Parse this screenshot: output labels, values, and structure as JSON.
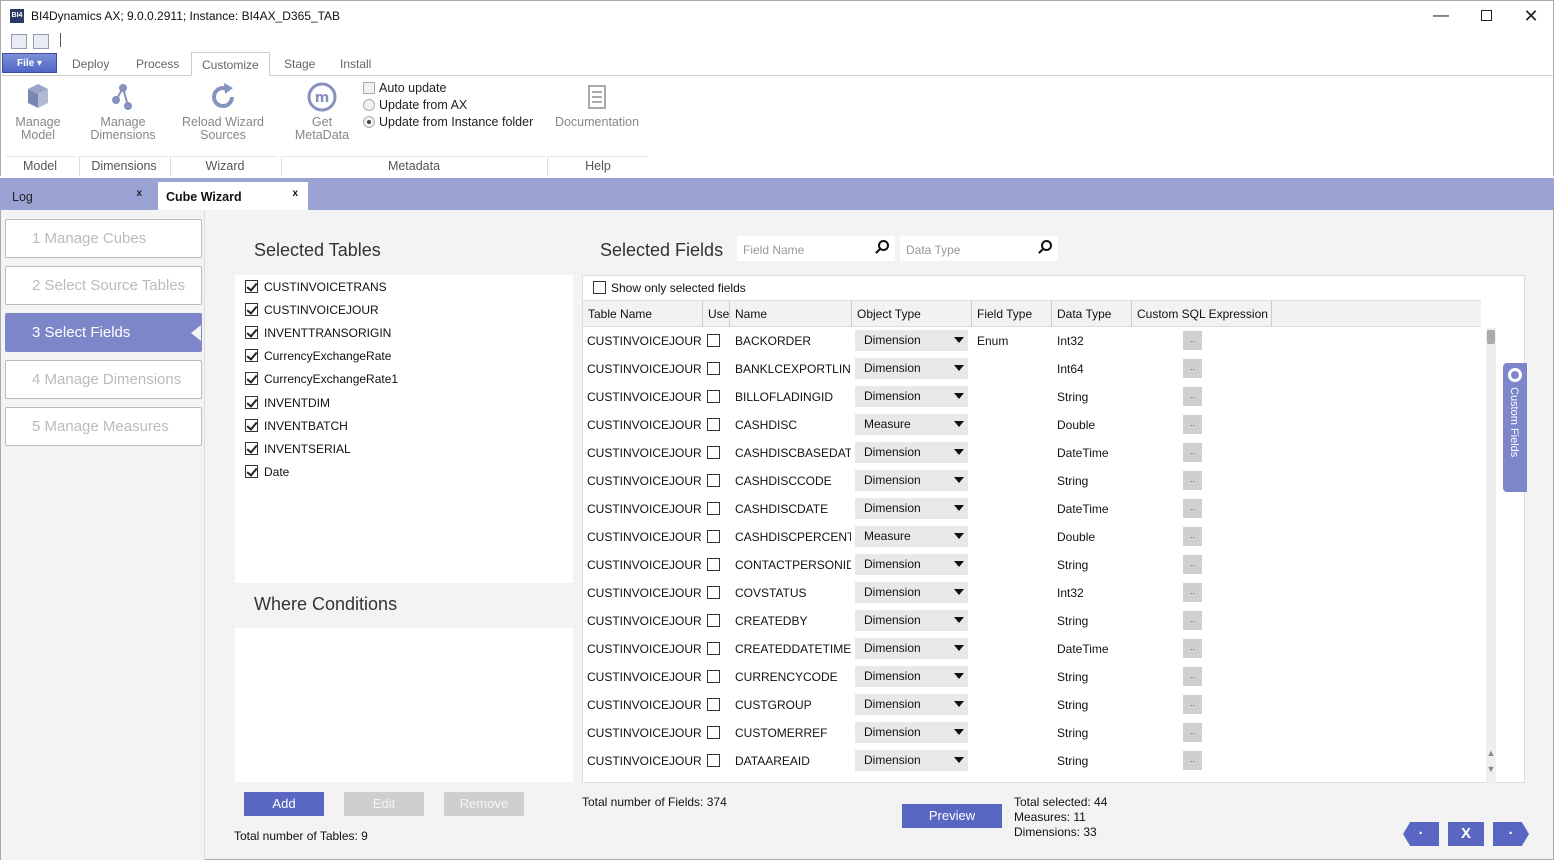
{
  "window": {
    "title": "BI4Dynamics AX; 9.0.0.2911;  Instance: BI4AX_D365_TAB",
    "app_icon_text": "BI4",
    "minimize": "—",
    "close": "✕"
  },
  "ribbon_tabs": {
    "file": "File ▾",
    "tabs": [
      "Deploy",
      "Process",
      "Customize",
      "Stage",
      "Install"
    ],
    "active": "Customize"
  },
  "ribbon": {
    "buttons": {
      "manage_model": "Manage\nModel",
      "manage_dimensions": "Manage\nDimensions",
      "reload_wizard": "Reload Wizard\nSources",
      "get_metadata": "Get\nMetaData",
      "documentation": "Documentation"
    },
    "options": {
      "auto_update": "Auto update",
      "update_from_ax": "Update from AX",
      "update_from_instance": "Update from Instance folder"
    },
    "groups": [
      "Model",
      "Dimensions",
      "Wizard",
      "Metadata",
      "Help"
    ]
  },
  "doc_tabs": {
    "log": "Log",
    "cube_wizard": "Cube Wizard",
    "close_glyph": "x"
  },
  "steps": [
    "1   Manage Cubes",
    "2   Select Source Tables",
    "3   Select Fields",
    "4   Manage Dimensions",
    "5   Manage Measures"
  ],
  "active_step": 3,
  "selected_tables": {
    "heading": "Selected Tables",
    "items": [
      "CUSTINVOICETRANS",
      "CUSTINVOICEJOUR",
      "INVENTTRANSORIGIN",
      "CurrencyExchangeRate",
      "CurrencyExchangeRate1",
      "INVENTDIM",
      "INVENTBATCH",
      "INVENTSERIAL",
      "Date"
    ]
  },
  "where_conditions": {
    "heading": "Where Conditions",
    "add": "Add",
    "edit": "Edit",
    "remove": "Remove",
    "total_tables": "Total number of Tables: 9"
  },
  "selected_fields": {
    "heading": "Selected Fields",
    "field_name_placeholder": "Field Name",
    "data_type_placeholder": "Data Type",
    "show_only_selected": "Show only selected fields",
    "columns": [
      "Table Name",
      "Use",
      "Name",
      "Object Type",
      "Field Type",
      "Data Type",
      "Custom SQL Expression"
    ],
    "rows": [
      {
        "table": "CUSTINVOICEJOUR",
        "name": "BACKORDER",
        "object_type": "Dimension",
        "field_type": "Enum",
        "data_type": "Int32"
      },
      {
        "table": "CUSTINVOICEJOUR",
        "name": "BANKLCEXPORTLINE",
        "object_type": "Dimension",
        "field_type": "",
        "data_type": "Int64"
      },
      {
        "table": "CUSTINVOICEJOUR",
        "name": "BILLOFLADINGID",
        "object_type": "Dimension",
        "field_type": "",
        "data_type": "String"
      },
      {
        "table": "CUSTINVOICEJOUR",
        "name": "CASHDISC",
        "object_type": "Measure",
        "field_type": "",
        "data_type": "Double"
      },
      {
        "table": "CUSTINVOICEJOUR",
        "name": "CASHDISCBASEDATE",
        "object_type": "Dimension",
        "field_type": "",
        "data_type": "DateTime"
      },
      {
        "table": "CUSTINVOICEJOUR",
        "name": "CASHDISCCODE",
        "object_type": "Dimension",
        "field_type": "",
        "data_type": "String"
      },
      {
        "table": "CUSTINVOICEJOUR",
        "name": "CASHDISCDATE",
        "object_type": "Dimension",
        "field_type": "",
        "data_type": "DateTime"
      },
      {
        "table": "CUSTINVOICEJOUR",
        "name": "CASHDISCPERCENT",
        "object_type": "Measure",
        "field_type": "",
        "data_type": "Double"
      },
      {
        "table": "CUSTINVOICEJOUR",
        "name": "CONTACTPERSONID",
        "object_type": "Dimension",
        "field_type": "",
        "data_type": "String"
      },
      {
        "table": "CUSTINVOICEJOUR",
        "name": "COVSTATUS",
        "object_type": "Dimension",
        "field_type": "",
        "data_type": "Int32"
      },
      {
        "table": "CUSTINVOICEJOUR",
        "name": "CREATEDBY",
        "object_type": "Dimension",
        "field_type": "",
        "data_type": "String"
      },
      {
        "table": "CUSTINVOICEJOUR",
        "name": "CREATEDDATETIME",
        "object_type": "Dimension",
        "field_type": "",
        "data_type": "DateTime"
      },
      {
        "table": "CUSTINVOICEJOUR",
        "name": "CURRENCYCODE",
        "object_type": "Dimension",
        "field_type": "",
        "data_type": "String"
      },
      {
        "table": "CUSTINVOICEJOUR",
        "name": "CUSTGROUP",
        "object_type": "Dimension",
        "field_type": "",
        "data_type": "String"
      },
      {
        "table": "CUSTINVOICEJOUR",
        "name": "CUSTOMERREF",
        "object_type": "Dimension",
        "field_type": "",
        "data_type": "String"
      },
      {
        "table": "CUSTINVOICEJOUR",
        "name": "DATAAREAID",
        "object_type": "Dimension",
        "field_type": "",
        "data_type": "String"
      }
    ],
    "sql_button_glyph": "..",
    "total_fields": "Total number of Fields: 374",
    "preview": "Preview",
    "total_selected": "Total selected: 44",
    "measures": "Measures: 11",
    "dimensions": "Dimensions: 33",
    "custom_fields": "Custom Fields"
  },
  "nav": {
    "prev": "·",
    "cancel": "X",
    "next": "·"
  },
  "colors": {
    "accent": "#5a67c2",
    "step_active": "#7d86c9",
    "tabstrip": "#9ba3d4"
  }
}
